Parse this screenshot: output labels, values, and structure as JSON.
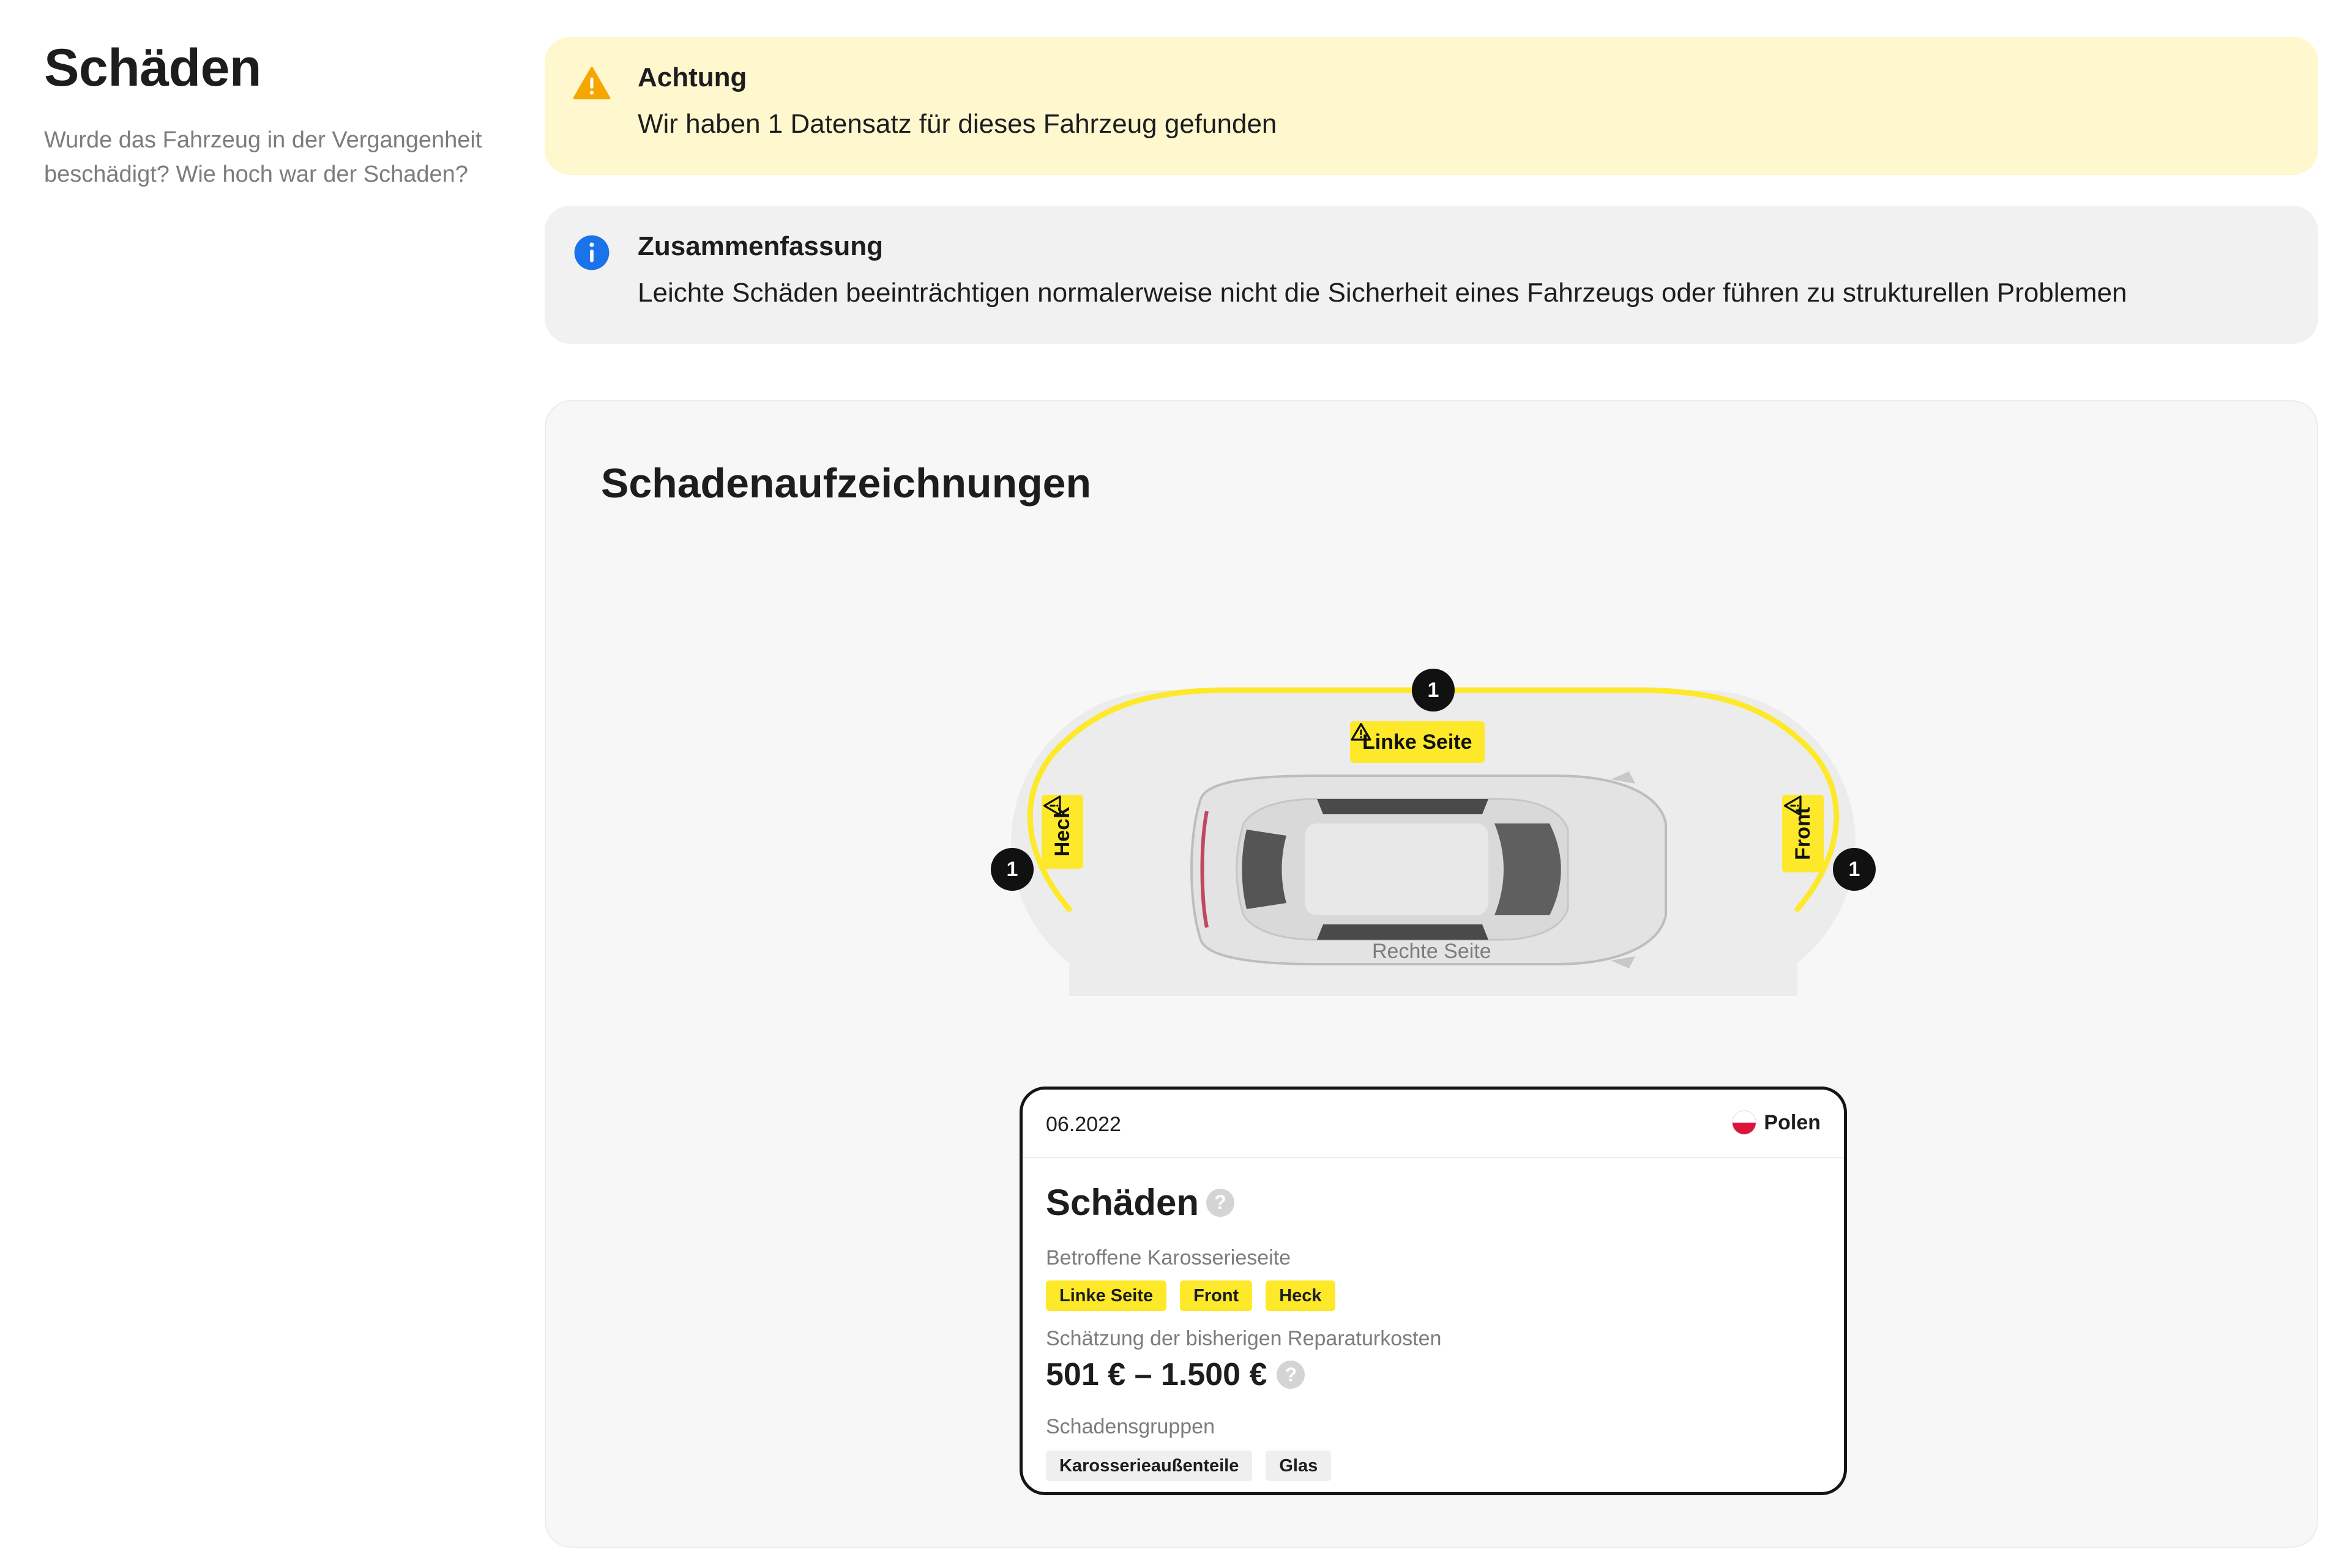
{
  "sidebar": {
    "title": "Schäden",
    "description": "Wurde das Fahrzeug in der Vergangenheit beschädigt? Wie hoch war der Schaden?"
  },
  "alerts": {
    "warning": {
      "icon": "warning-icon",
      "title": "Achtung",
      "text": "Wir haben 1 Datensatz für dieses Fahrzeug gefunden",
      "color": "#f5a700"
    },
    "info": {
      "icon": "info-icon",
      "title": "Zusammenfassung",
      "text": "Leichte Schäden beeinträchtigen normalerweise nicht die Sicherheit eines Fahrzeugs oder führen zu strukturellen Problemen",
      "color": "#1a73e8"
    }
  },
  "records": {
    "title": "Schadenaufzeichnungen",
    "diagram": {
      "top": {
        "label": "Linke Seite",
        "count": "1"
      },
      "left": {
        "label": "Heck",
        "count": "1"
      },
      "right": {
        "label": "Front",
        "count": "1"
      },
      "bottom": {
        "label": "Rechte Seite"
      },
      "highlight_color": "#fde92a"
    },
    "card": {
      "date": "06.2022",
      "country": "Polen",
      "title": "Schäden",
      "help": "?",
      "affected_label": "Betroffene Karosserieseite",
      "affected": [
        "Linke Seite",
        "Front",
        "Heck"
      ],
      "cost_label": "Schätzung der bisherigen Reparaturkosten",
      "cost": "501 € – 1.500 €",
      "groups_label": "Schadensgruppen",
      "groups": [
        "Karosserieaußenteile",
        "Glas"
      ]
    }
  }
}
